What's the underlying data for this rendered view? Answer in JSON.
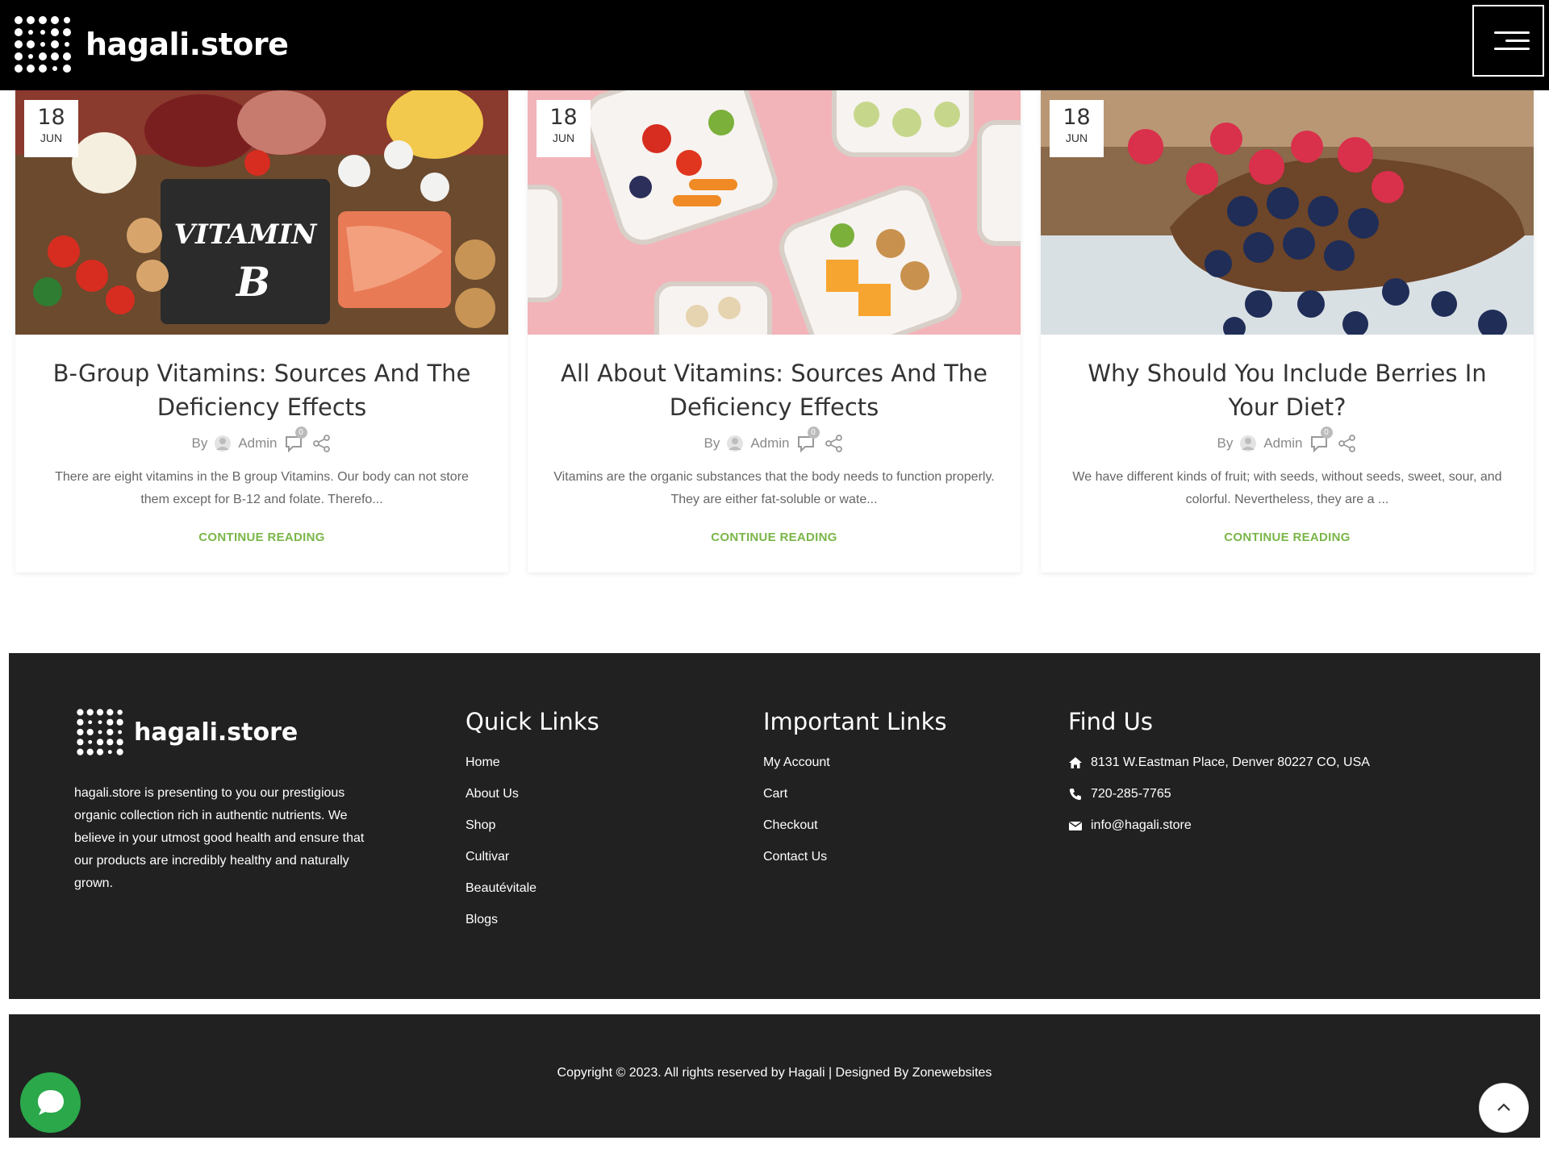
{
  "header": {
    "logo_text": "hagali.store",
    "menu_icon": "hamburger-icon"
  },
  "posts": [
    {
      "date_day": "18",
      "date_month": "JUN",
      "title": "B-Group Vitamins: Sources And The Deficiency Effects",
      "image_caption_line1": "VITAMIN",
      "image_caption_line2": "B",
      "by": "By",
      "author": "Admin",
      "comments": "0",
      "excerpt": "There are eight vitamins in the B group Vitamins. Our body can not store them except for B-12 and folate. Therefo...",
      "read_more": "CONTINUE READING"
    },
    {
      "date_day": "18",
      "date_month": "JUN",
      "title": "All About Vitamins: Sources And The Deficiency Effects",
      "by": "By",
      "author": "Admin",
      "comments": "0",
      "excerpt": "Vitamins are the organic substances that the body needs to function properly. They are either fat-soluble or wate...",
      "read_more": "CONTINUE READING"
    },
    {
      "date_day": "18",
      "date_month": "JUN",
      "title": "Why Should You Include Berries In Your Diet?",
      "by": "By",
      "author": "Admin",
      "comments": "0",
      "excerpt": "We have different kinds of fruit; with seeds, without seeds, sweet, sour, and colorful. Nevertheless, they are a ...",
      "read_more": "CONTINUE READING"
    }
  ],
  "footer": {
    "logo_text": "hagali.store",
    "about": "hagali.store is presenting to you our prestigious organic collection rich in authentic nutrients. We believe in your utmost good health and ensure that our products are incredibly healthy and naturally grown.",
    "quick_links": {
      "title": "Quick Links",
      "items": [
        "Home",
        "About Us",
        "Shop",
        "Cultivar",
        "Beautévitale",
        "Blogs"
      ]
    },
    "important_links": {
      "title": "Important Links",
      "items": [
        "My Account",
        "Cart",
        "Checkout",
        "Contact Us"
      ]
    },
    "find_us": {
      "title": "Find Us",
      "address": "8131 W.Eastman Place, Denver 80227 CO, USA",
      "phone": "720-285-7765",
      "email": "info@hagali.store"
    }
  },
  "copyright": "Copyright © 2023. All rights reserved by Hagali | Designed By Zonewebsites",
  "colors": {
    "accent_green": "#7ab648",
    "header_bg": "#000000",
    "footer_bg": "#212121",
    "chat_green": "#2aa84a"
  }
}
